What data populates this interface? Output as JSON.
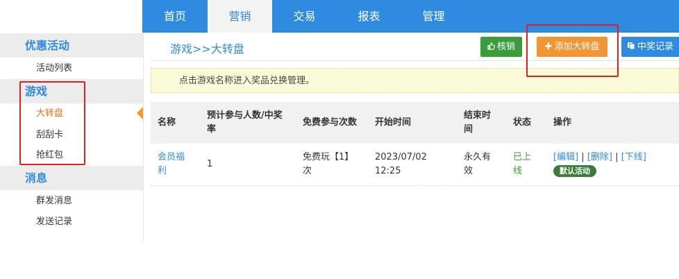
{
  "topnav": {
    "tabs": [
      {
        "label": "首页"
      },
      {
        "label": "营销"
      },
      {
        "label": "交易"
      },
      {
        "label": "报表"
      },
      {
        "label": "管理"
      }
    ],
    "active_index": 1
  },
  "sidebar": {
    "groups": [
      {
        "title": "优惠活动",
        "items": [
          "活动列表"
        ]
      },
      {
        "title": "游戏",
        "items": [
          "大转盘",
          "刮刮卡",
          "抢红包"
        ]
      },
      {
        "title": "消息",
        "items": [
          "群发消息",
          "发送记录"
        ]
      }
    ],
    "active_item": "大转盘"
  },
  "main": {
    "breadcrumb": "游戏>>大转盘",
    "buttons": {
      "verify": "核销",
      "add_wheel": "添加大转盘",
      "win_records": "中奖记录"
    },
    "notice": "点击游戏名称进入奖品兑换管理。",
    "table": {
      "headers": [
        "名称",
        "预计参与人数/中奖率",
        "免费参与次数",
        "开始时间",
        "结束时间",
        "状态",
        "操作"
      ],
      "rows": [
        {
          "name": "会员福利",
          "expected": "1",
          "free_times": "免费玩【1】次",
          "start": "2023/07/02 12:25",
          "end": "永久有效",
          "status": "已上线",
          "actions": {
            "edit": "[编辑]",
            "sep1": "|",
            "delete": "[删除]",
            "sep2": "|",
            "offline": "[下线]"
          },
          "badge": "默认活动"
        }
      ]
    }
  },
  "colors": {
    "primary": "#2e8be0",
    "orange": "#f29533",
    "green": "#3a9c3a",
    "annotation": "#e02020"
  }
}
